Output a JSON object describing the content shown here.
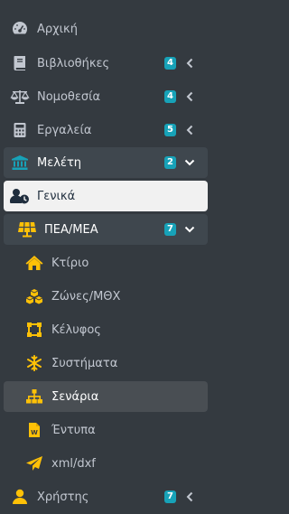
{
  "nav": {
    "home": {
      "label": "Αρχική",
      "icon": "tachometer-icon"
    },
    "libraries": {
      "label": "Βιβλιοθήκες",
      "badge": "4",
      "icon": "book-icon"
    },
    "legislation": {
      "label": "Νομοθεσία",
      "badge": "4",
      "icon": "balance-scale-icon"
    },
    "tools": {
      "label": "Εργαλεία",
      "badge": "5",
      "icon": "calculator-icon"
    },
    "study": {
      "label": "Μελέτη",
      "badge": "2",
      "icon": "university-icon"
    },
    "general": {
      "label": "Γενικά",
      "icon": "user-clock-icon"
    },
    "pea": {
      "label": "ΠΕΑ/ΜΕΑ",
      "badge": "7",
      "icon": "solar-panel-icon"
    },
    "pea_items": [
      {
        "label": "Κτίριο",
        "icon": "home-icon"
      },
      {
        "label": "Ζώνες/ΜΘΧ",
        "icon": "cubes-icon"
      },
      {
        "label": "Κέλυφος",
        "icon": "vector-square-icon"
      },
      {
        "label": "Συστήματα",
        "icon": "snowflake-icon"
      },
      {
        "label": "Σενάρια",
        "icon": "sitemap-icon"
      },
      {
        "label": "Έντυπα",
        "icon": "word-file-icon"
      },
      {
        "label": "xml/dxf",
        "icon": "paper-plane-icon"
      }
    ],
    "user": {
      "label": "Χρήστης",
      "badge": "7",
      "icon": "user-icon"
    }
  },
  "colors": {
    "background": "#343a40",
    "text": "#c2c7d0",
    "badge": "#17a2b8",
    "sub_icon": "#ffc107",
    "study_icon": "#17a2b8"
  }
}
